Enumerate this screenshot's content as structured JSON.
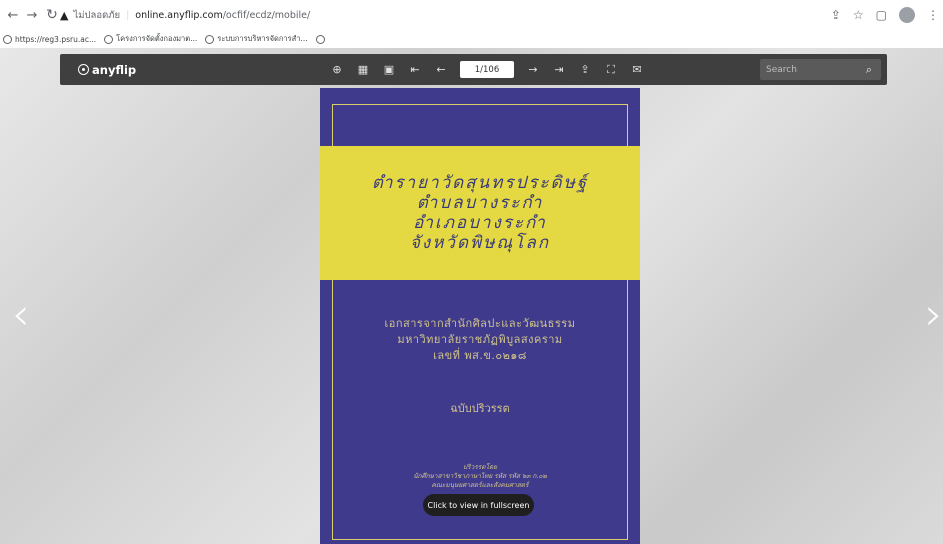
{
  "browser": {
    "insecure_label": "ไม่ปลอดภัย",
    "url_host": "online.anyflip.com",
    "url_path": "/ocfif/ecdz/mobile/",
    "bookmarks": [
      {
        "label": "https://reg3.psru.ac..."
      },
      {
        "label": "โครงการจัดตั้งกองมาต..."
      },
      {
        "label": "ระบบการบริหารจัดการสำ..."
      }
    ]
  },
  "toolbar": {
    "logo": "anyflip",
    "page_indicator": "1/106",
    "search_placeholder": "Search"
  },
  "book": {
    "title_lines": [
      "ตำรายาวัดสุนทรประดิษฐ์",
      "ตำบลบางระกำ",
      "อำเภอบางระกำ",
      "จังหวัดพิษณุโลก"
    ],
    "subtitle_lines": [
      "เอกสารจากสำนักศิลปะและวัฒนธรรม",
      "มหาวิทยาลัยราชภัฏพิบูลสงคราม",
      "เลขที่ พส.ข.๐๒๑๘"
    ],
    "edition": "ฉบับปริวรรต",
    "credit_lines": [
      "ปริวรรตโดย",
      "นักศึกษาสาขาวิชาภาษาไทย รหัส รหัส ๖๓ ก.๐๒",
      "คณะมนุษยศาสตร์และสังคมศาสตร์"
    ]
  },
  "fullscreen_hint": "Click to view in fullscreen",
  "colors": {
    "cover": "#3f3a8c",
    "band": "#e4d943",
    "toolbar": "#3f3f3f"
  }
}
